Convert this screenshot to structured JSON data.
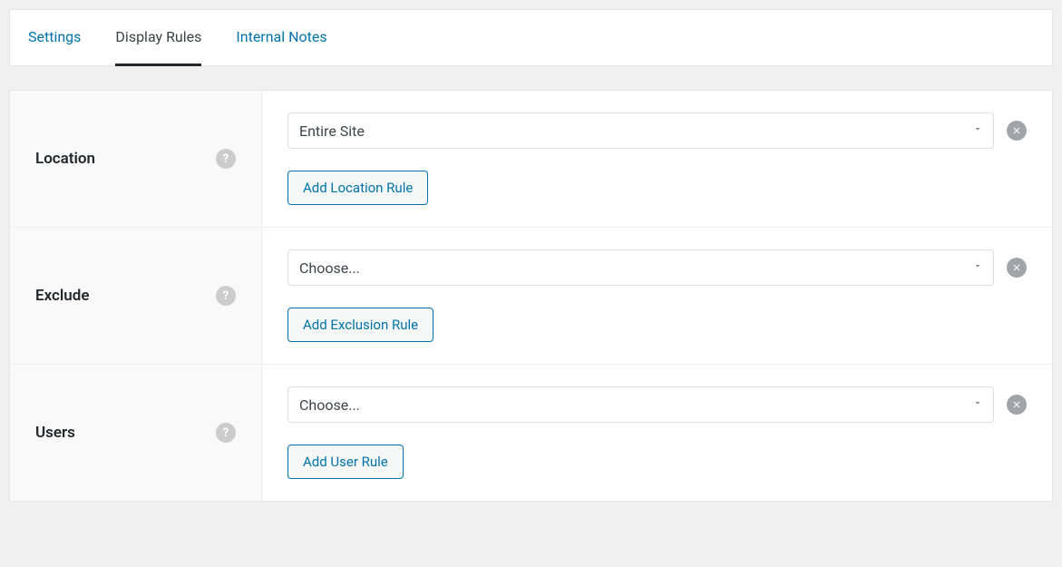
{
  "tabs": {
    "settings": "Settings",
    "display_rules": "Display Rules",
    "internal_notes": "Internal Notes"
  },
  "rules": {
    "location": {
      "label": "Location",
      "select_value": "Entire Site",
      "button_label": "Add Location Rule"
    },
    "exclude": {
      "label": "Exclude",
      "select_value": "Choose...",
      "button_label": "Add Exclusion Rule"
    },
    "users": {
      "label": "Users",
      "select_value": "Choose...",
      "button_label": "Add User Rule"
    }
  }
}
